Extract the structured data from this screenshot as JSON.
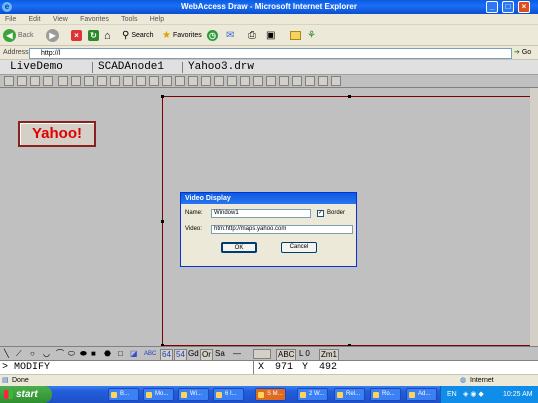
{
  "window": {
    "title": "WebAccess Draw - Microsoft Internet Explorer",
    "min": "_",
    "max": "□",
    "close": "×"
  },
  "menu": [
    "File",
    "Edit",
    "View",
    "Favorites",
    "Tools",
    "Help"
  ],
  "toolbar": {
    "back": "Back",
    "search": "Search",
    "favorites": "Favorites"
  },
  "address": {
    "label": "Address",
    "value": "http://l",
    "go": "Go"
  },
  "tabs": {
    "project": "LiveDemo",
    "node": "SCADAnode1",
    "file": "Yahoo3.drw"
  },
  "canvas": {
    "yahoo_button": "Yahoo!"
  },
  "dialog": {
    "title": "Video Display",
    "name_label": "Name:",
    "name_value": "Window1",
    "border_label": "Border",
    "border_checked": true,
    "video_label": "Video:",
    "video_value": "htm:http://maps.yahoo.com",
    "ok": "OK",
    "cancel": "Cancel"
  },
  "bottom_toolbar": {
    "gd": "Gd",
    "or": "Or",
    "sa": "Sa",
    "line": "—",
    "abc": "ABC",
    "layer": "L 0",
    "zoom": "Zm1"
  },
  "command": {
    "prompt": "> MODIFY",
    "x_label": "X",
    "x_value": "971",
    "y_label": "Y",
    "y_value": "492"
  },
  "status": {
    "left": "Done",
    "zone": "Internet"
  },
  "taskbar": {
    "start": "start",
    "tasks": [
      "B...",
      "Mo...",
      "Wi...",
      "6 I...",
      "S M...",
      "2 W...",
      "Rel...",
      "Ro...",
      "Ad..."
    ],
    "lang": "EN",
    "clock": "10:25 AM"
  },
  "colors": {
    "accent": "#0a5ce0",
    "yahoo_red": "#e00000"
  }
}
